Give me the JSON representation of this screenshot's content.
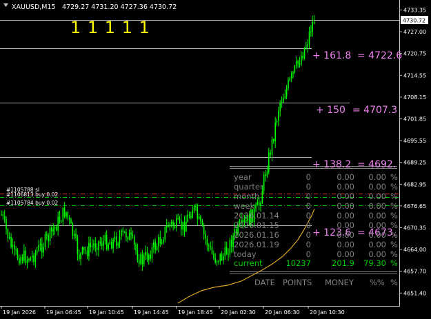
{
  "header": {
    "symbol": "XAUUSD,M15",
    "ohlc": "4729.27 4731.20 4727.36 4730.72",
    "indicator": "1 1 1 1 1"
  },
  "price_axis": {
    "ticks": [
      "4733.35",
      "4727.00",
      "4720.75",
      "4714.55",
      "4708.15",
      "4701.85",
      "4695.55",
      "4689.25",
      "4682.95",
      "4676.65",
      "4670.35",
      "4664.00",
      "4657.70",
      "4651.40"
    ],
    "current": "4730.72"
  },
  "time_axis": {
    "ticks": [
      "19 Jan 2026",
      "19 Jan 06:45",
      "19 Jan 10:45",
      "19 Jan 14:45",
      "19 Jan 18:45",
      "20 Jan 02:30",
      "20 Jan 06:30",
      "20 Jan 10:30"
    ]
  },
  "fib_levels": [
    {
      "pct": "+ 161.8",
      "value": "= 4722.6"
    },
    {
      "pct": "+ 150",
      "value": "= 4707.3"
    },
    {
      "pct": "+ 138.2",
      "value": "= 4692."
    },
    {
      "pct": "+ 123.6",
      "value": "= 4673."
    }
  ],
  "orders": [
    {
      "label": "#1105788 sl",
      "color": "#ff3030"
    },
    {
      "label": "#1106813 buy 0.02",
      "color": "#ffffff"
    },
    {
      "label": "#1105784 buy 0.02",
      "color": "#ffffff"
    }
  ],
  "stats": {
    "rows": [
      {
        "label": "year",
        "count": "0",
        "points": "0.00",
        "pct": "0.00",
        "unit": "%"
      },
      {
        "label": "quarter",
        "count": "0",
        "points": "0.00",
        "pct": "0.00",
        "unit": "%"
      },
      {
        "label": "month",
        "count": "0",
        "points": "0.00",
        "pct": "0.00",
        "unit": "%"
      },
      {
        "label": "week",
        "count": "0",
        "points": "0.00",
        "pct": "0.00",
        "unit": "%"
      },
      {
        "label": "2026.01.14",
        "count": "0",
        "points": "0.00",
        "pct": "0.00",
        "unit": "%"
      },
      {
        "label": "2026.01.15",
        "count": "0",
        "points": "0.00",
        "pct": "0.00",
        "unit": "%"
      },
      {
        "label": "2026.01.16",
        "count": "0",
        "points": "0.00",
        "pct": "0.00",
        "unit": "%"
      },
      {
        "label": "2026.01.19",
        "count": "0",
        "points": "0.00",
        "pct": "0.00",
        "unit": "%"
      },
      {
        "label": "today",
        "count": "0",
        "points": "0.00",
        "pct": "0.00",
        "unit": "%"
      }
    ],
    "current": {
      "label": "current",
      "count": "10237",
      "points": "201.9",
      "pct": "79.30",
      "unit": "%"
    },
    "footer": {
      "date": "DATE",
      "points": "POINTS",
      "money": "MONEY",
      "pct": "%%",
      "unit": "%"
    }
  },
  "colors": {
    "background": "#000000",
    "bull": "#00ff00",
    "text": "#c8c8c8",
    "fib": "#ee82ee",
    "indicator": "#ffff00",
    "ma": "#daa520",
    "stats": "#808080",
    "current": "#00cc00"
  }
}
